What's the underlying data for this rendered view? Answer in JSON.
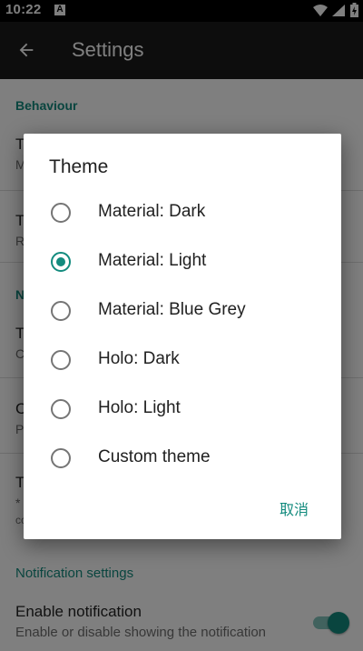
{
  "status_bar": {
    "time": "10:22",
    "notification_icon": "A",
    "icons": [
      "wifi-icon",
      "signal-icon",
      "battery-icon"
    ]
  },
  "app_bar": {
    "title": "Settings",
    "back_icon": "arrow-back-icon"
  },
  "settings": {
    "section_behaviour": "Behaviour",
    "rows_partial": [
      {
        "title_visible": "T",
        "subtitle_visible": "M"
      },
      {
        "title_visible": "T",
        "subtitle_visible": "R"
      },
      {
        "section_visible": "N"
      },
      {
        "title_visible": "T",
        "subtitle_visible": "C"
      },
      {
        "title_visible": "C",
        "subtitle_visible": "P"
      },
      {
        "title_visible": "T",
        "subtitle_visible": "*",
        "subtitle2_visible": "cc"
      }
    ],
    "section_notification": "Notification settings",
    "enable_notification": {
      "title": "Enable notification",
      "subtitle": "Enable or disable showing the notification",
      "enabled": true
    }
  },
  "dialog": {
    "title": "Theme",
    "options": [
      {
        "label": "Material: Dark",
        "selected": false
      },
      {
        "label": "Material: Light",
        "selected": true
      },
      {
        "label": "Material: Blue Grey",
        "selected": false
      },
      {
        "label": "Holo: Dark",
        "selected": false
      },
      {
        "label": "Holo: Light",
        "selected": false
      },
      {
        "label": "Custom theme",
        "selected": false
      }
    ],
    "cancel_label": "取消"
  },
  "colors": {
    "accent": "#138b7e",
    "status_bar": "#000000",
    "app_bar": "#1b1b1b",
    "scrim": "rgba(0,0,0,0.5)"
  }
}
